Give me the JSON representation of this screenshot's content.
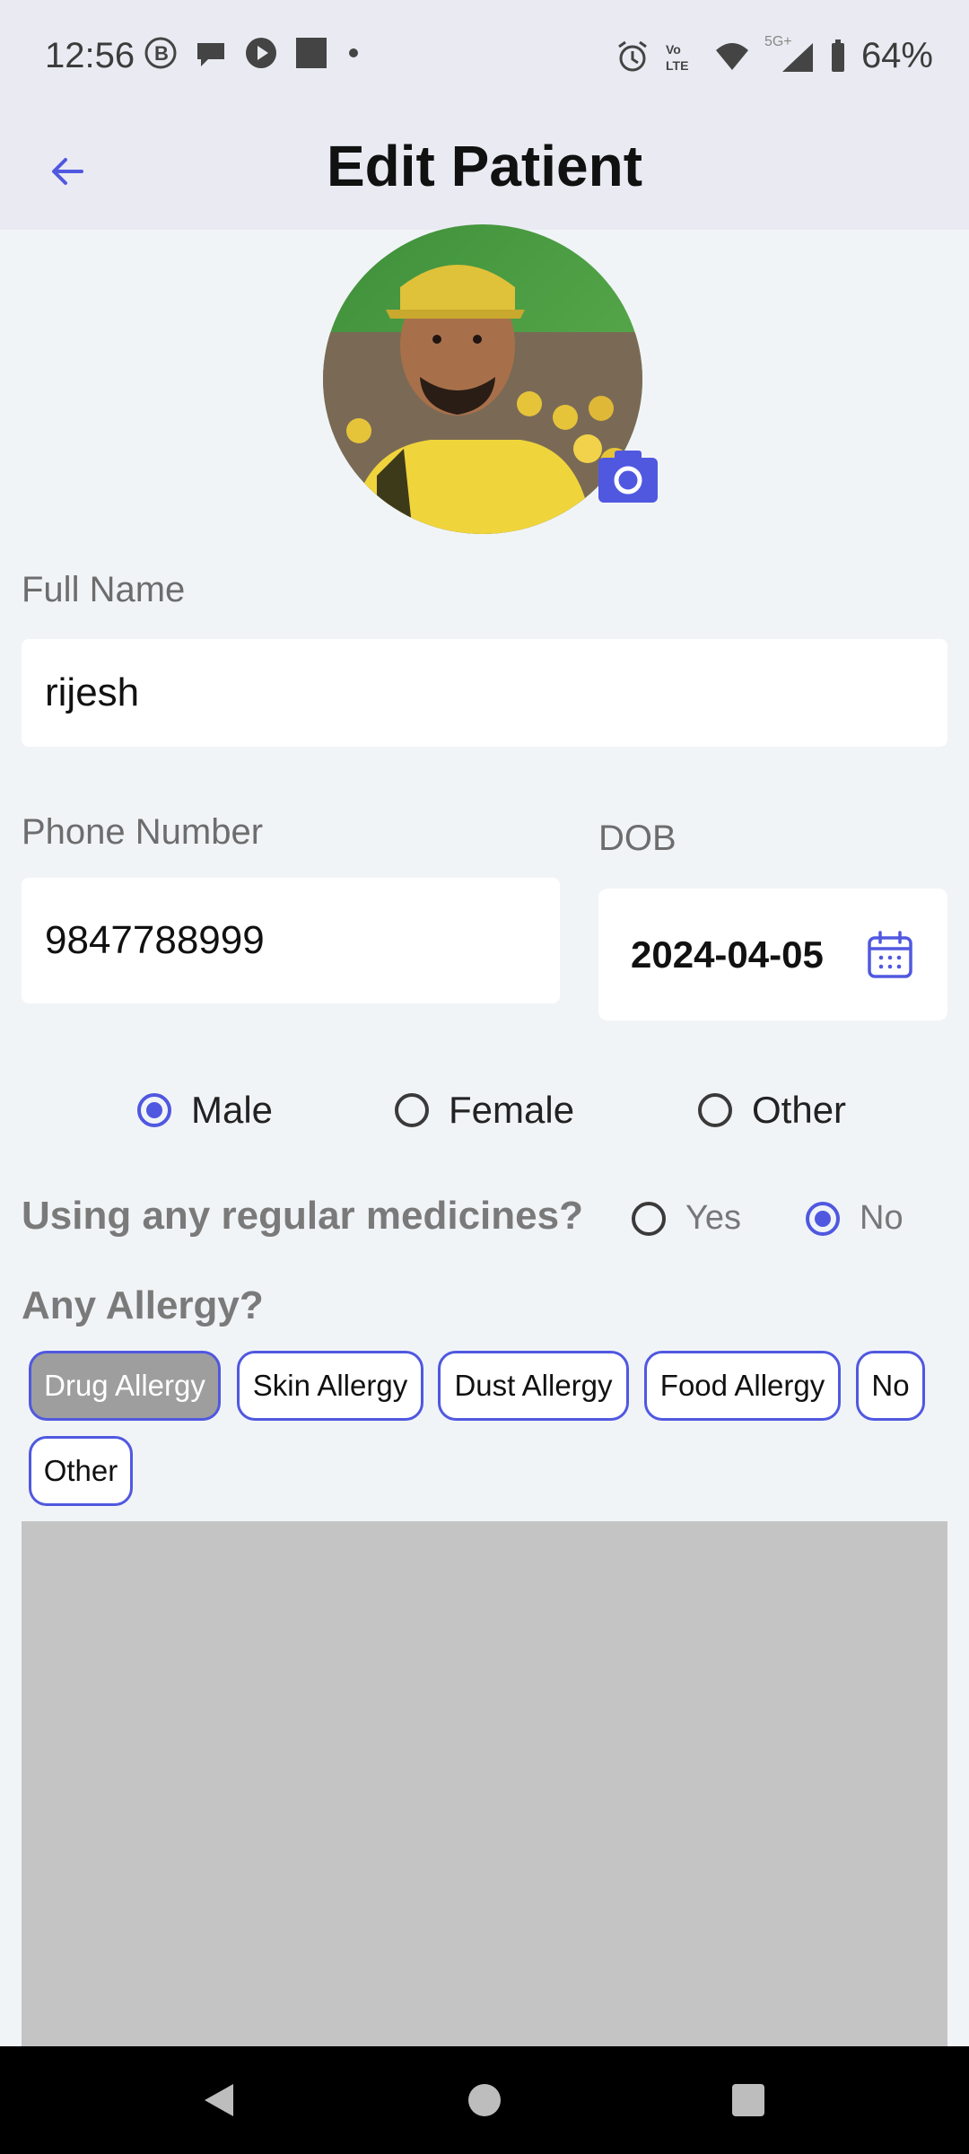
{
  "status_bar": {
    "time": "12:56",
    "battery": "64%",
    "network": "5G+",
    "icons_left": [
      "b-icon",
      "chat-icon",
      "play-icon",
      "square-icon",
      "dot-icon"
    ],
    "icons_right": [
      "alarm-icon",
      "volte-icon",
      "wifi-icon",
      "signal-icon",
      "battery-icon"
    ]
  },
  "app_bar": {
    "title": "Edit Patient",
    "back_icon": "arrow-left-icon"
  },
  "profile": {
    "photo_icon": "profile-photo",
    "camera_icon": "camera-icon"
  },
  "form": {
    "full_name": {
      "label": "Full Name",
      "value": "rijesh"
    },
    "phone": {
      "label": "Phone Number",
      "value": "9847788999"
    },
    "dob": {
      "label": "DOB",
      "value": "2024-04-05",
      "icon": "calendar-icon"
    },
    "gender": {
      "options": [
        "Male",
        "Female",
        "Other"
      ],
      "selected": "Male"
    },
    "medicines": {
      "question": "Using any regular medicines?",
      "options": [
        "Yes",
        "No"
      ],
      "selected": "No"
    },
    "allergy": {
      "title": "Any Allergy?",
      "chips": [
        "Drug Allergy",
        "Skin Allergy",
        "Dust Allergy",
        "Food Allergy",
        "No",
        "Other"
      ],
      "selected": "Drug Allergy"
    }
  },
  "colors": {
    "accent": "#5058e0",
    "app_bar_bg": "#eaebf2",
    "page_bg": "#f1f4f7",
    "chip_selected_bg": "#9e9e9e",
    "placeholder_block": "#c4c4c4"
  },
  "nav_bar": {
    "icons": [
      "back-triangle-icon",
      "home-circle-icon",
      "recents-square-icon"
    ]
  }
}
